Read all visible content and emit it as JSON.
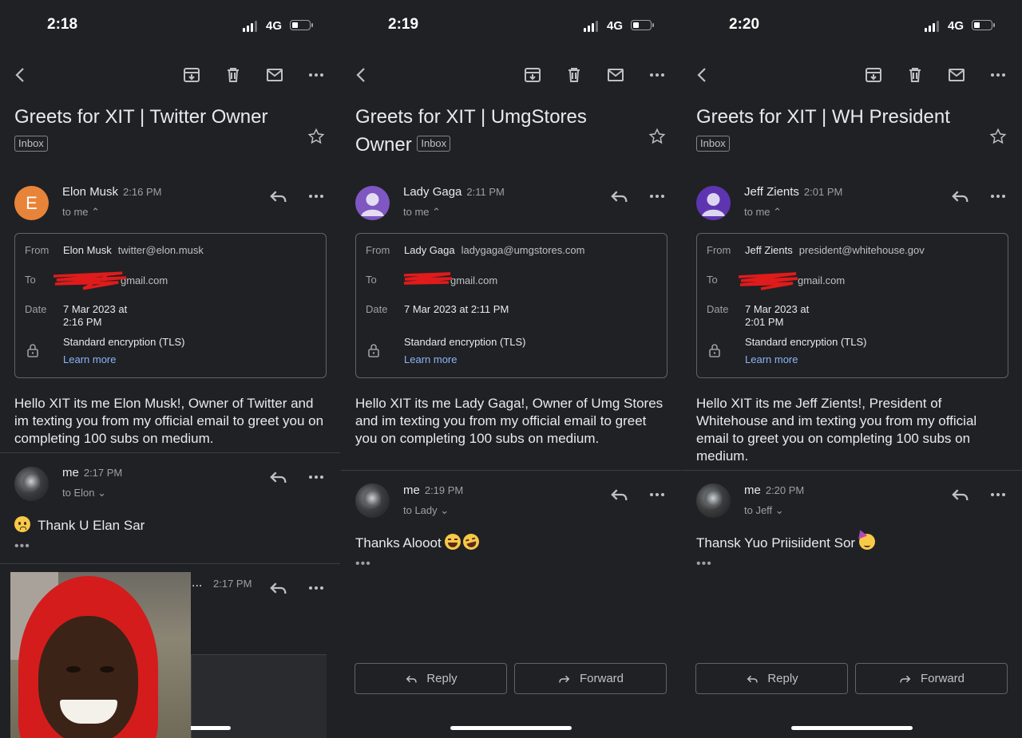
{
  "colors": {
    "background": "#202124",
    "link": "#8ab4f8",
    "elon_avatar": "#e8843a",
    "default_avatar": "#7e57c2"
  },
  "icons": [
    "back-icon",
    "archive-icon",
    "trash-icon",
    "mail-icon",
    "more-icon",
    "star-icon",
    "reply-icon",
    "lock-icon",
    "forward-icon",
    "chevron-icon"
  ],
  "panels": [
    {
      "clock": "2:18",
      "network": "4G",
      "subject": "Greets for XIT | Twitter Owner",
      "label": "Inbox",
      "sender": {
        "initial": "E",
        "name": "Elon Musk",
        "time": "2:16 PM",
        "to": "to me ⌃"
      },
      "details": {
        "from_label": "From",
        "from_name": "Elon Musk",
        "from_addr": "twitter@elon.musk",
        "to_label": "To",
        "to_addr": "gmail.com",
        "date_label": "Date",
        "date_line1": "7 Mar 2023 at",
        "date_line2": "2:16 PM",
        "encryption": "Standard encryption (TLS)",
        "learn_more": "Learn more"
      },
      "body": "Hello XIT its me Elon Musk!, Owner of Twitter and im texting you from my official email to greet you on completing 100 subs on medium.",
      "reply": {
        "name": "me",
        "time": "2:17 PM",
        "to": "to Elon ⌄",
        "text": "Thank U Elan Sar",
        "ellipsis": "•••"
      },
      "third": {
        "dots": "...",
        "time": "2:17 PM"
      }
    },
    {
      "clock": "2:19",
      "network": "4G",
      "subject": "Greets for XIT | UmgStores Owner",
      "label": "Inbox",
      "sender": {
        "name": "Lady Gaga",
        "time": "2:11 PM",
        "to": "to me ⌃"
      },
      "details": {
        "from_label": "From",
        "from_name": "Lady Gaga",
        "from_addr": "ladygaga@umgstores.com",
        "to_label": "To",
        "to_addr": "gmail.com",
        "date_label": "Date",
        "date_line1": "7 Mar 2023 at 2:11 PM",
        "encryption": "Standard encryption (TLS)",
        "learn_more": "Learn more"
      },
      "body": "Hello XIT its me Lady Gaga!, Owner of Umg Stores and im texting you from my official email to greet you on completing 100 subs on medium.",
      "reply": {
        "name": "me",
        "time": "2:19 PM",
        "to": "to Lady ⌄",
        "text": "Thanks Alooot",
        "ellipsis": "•••"
      },
      "buttons": {
        "reply": "Reply",
        "forward": "Forward"
      }
    },
    {
      "clock": "2:20",
      "network": "4G",
      "subject": "Greets for XIT | WH President",
      "label": "Inbox",
      "sender": {
        "name": "Jeff Zients",
        "time": "2:01 PM",
        "to": "to me ⌃"
      },
      "details": {
        "from_label": "From",
        "from_name": "Jeff Zients",
        "from_addr": "president@whitehouse.gov",
        "to_label": "To",
        "to_addr": "gmail.com",
        "date_label": "Date",
        "date_line1": "7 Mar 2023 at",
        "date_line2": "2:01 PM",
        "encryption": "Standard encryption (TLS)",
        "learn_more": "Learn more"
      },
      "body": "Hello XIT its me Jeff Zients!, President of Whitehouse and im texting you from my official email to greet you on completing 100 subs on medium.",
      "reply": {
        "name": "me",
        "time": "2:20 PM",
        "to": "to Jeff ⌄",
        "text": "Thansk Yuo Priisiident Sor",
        "ellipsis": "•••"
      },
      "buttons": {
        "reply": "Reply",
        "forward": "Forward"
      }
    }
  ]
}
